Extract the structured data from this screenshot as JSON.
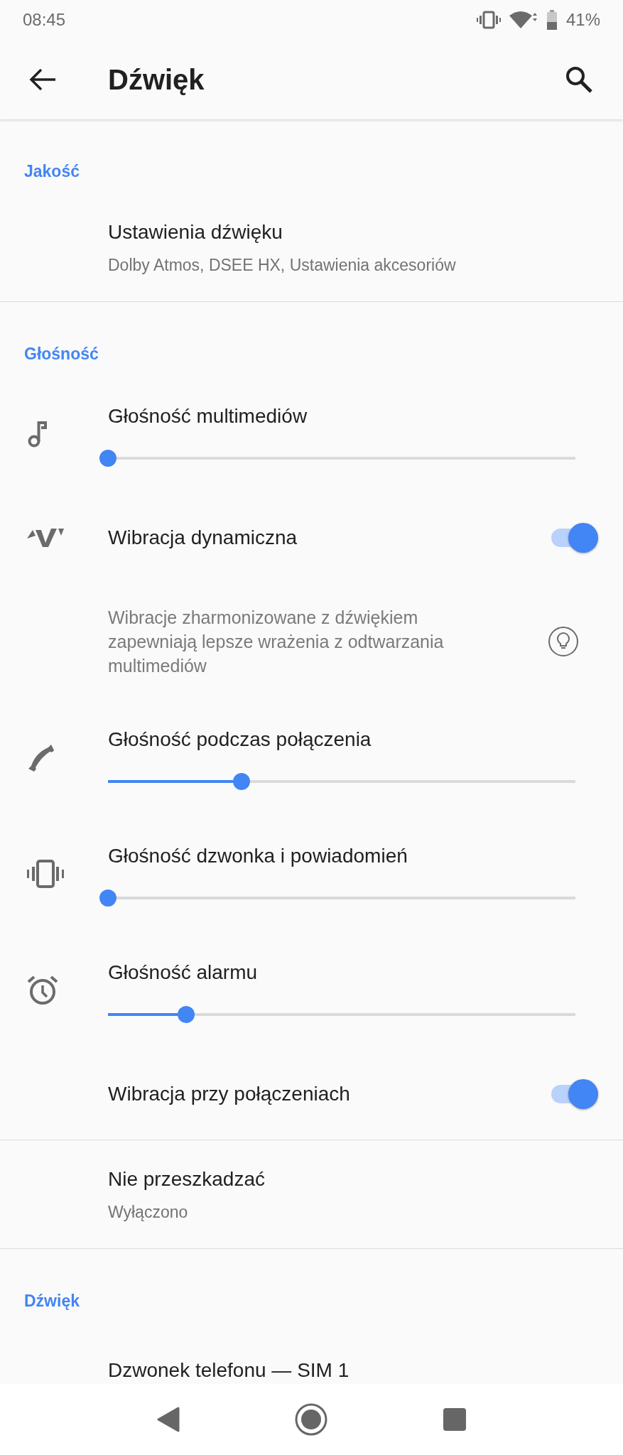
{
  "status_bar": {
    "time": "08:45",
    "battery": "41%"
  },
  "app_bar": {
    "title": "Dźwięk"
  },
  "sections": [
    {
      "header": "Jakość",
      "items": [
        {
          "kind": "link",
          "title": "Ustawienia dźwięku",
          "subtitle": "Dolby Atmos, DSEE HX, Ustawienia akcesoriów"
        }
      ]
    },
    {
      "header": "Głośność",
      "items": [
        {
          "kind": "slider",
          "title": "Głośność multimediów",
          "level": 0
        },
        {
          "kind": "toggle",
          "title": "Wibracja dynamiczna",
          "on": true
        },
        {
          "kind": "description",
          "text": "Wibracje zharmonizowane z dźwiękiem zapewniają lepsze wrażenia z odtwarzania multimediów"
        },
        {
          "kind": "slider",
          "title": "Głośność podczas połączenia",
          "level": 0.286
        },
        {
          "kind": "slider",
          "title": "Głośność dzwonka i powiadomień",
          "level": 0
        },
        {
          "kind": "slider",
          "title": "Głośność alarmu",
          "level": 0.167
        },
        {
          "kind": "toggle",
          "title": "Wibracja przy połączeniach",
          "on": true
        }
      ]
    },
    {
      "items": [
        {
          "kind": "link",
          "title": "Nie przeszkadzać",
          "subtitle": "Wyłączono"
        }
      ]
    },
    {
      "header": "Dźwięk",
      "items": [
        {
          "kind": "link",
          "title": "Dzwonek telefonu — SIM 1"
        }
      ]
    }
  ]
}
